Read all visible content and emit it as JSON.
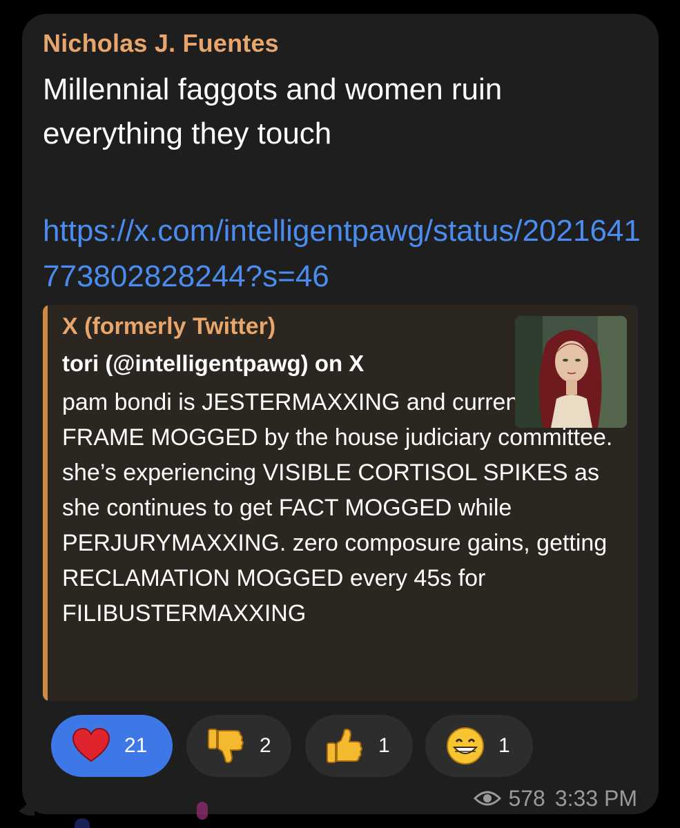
{
  "message": {
    "sender": "Nicholas J. Fuentes",
    "text_line1": "Millennial faggots and women ruin",
    "text_line2": "everything they touch",
    "link": "https://x.com/intelligentpawg/status/2021641773802828244?s=46"
  },
  "preview": {
    "site": "X (formerly Twitter)",
    "title": "tori (@intelligentpawg) on X",
    "text": "pam bondi is JESTERMAXXING and currently being FRAME MOGGED by the house judiciary committee. she’s experiencing VISIBLE CORTISOL SPIKES as she continues to get FACT MOGGED while PERJURYMAXXING. zero composure gains, getting RECLAMATION MOGGED every 45s for FILIBUSTERMAXXING",
    "thumbnail": "avatar-portrait-image"
  },
  "reactions": [
    {
      "icon": "red-heart-icon",
      "count": "21",
      "selected": true
    },
    {
      "icon": "thumbs-down-icon",
      "count": "2",
      "selected": false
    },
    {
      "icon": "thumbs-up-icon",
      "count": "1",
      "selected": false
    },
    {
      "icon": "grinning-face-icon",
      "count": "1",
      "selected": false
    }
  ],
  "footer": {
    "views": "578",
    "time": "3:33 PM"
  },
  "colors": {
    "background": "#000000",
    "bubble": "#1e1e1e",
    "sender": "#e8a66c",
    "link": "#4b8cf0",
    "preview_bg": "#2c2620",
    "preview_accent": "#d18a43",
    "reaction_selected": "#3d78e6",
    "reaction_default": "#2d2d2d"
  }
}
